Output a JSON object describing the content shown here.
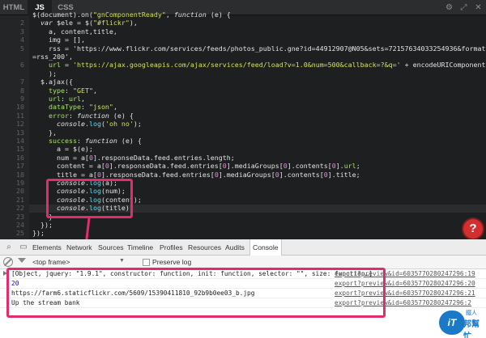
{
  "editor": {
    "tabs": [
      "HTML",
      "JS",
      "CSS"
    ],
    "active_tab": "JS",
    "toolbar_icons": [
      "settings-icon",
      "expand-icon",
      "close-icon"
    ],
    "lines": [
      {
        "num": "",
        "text": "$(document).on(\"gnComponentReady\", function (e) {"
      },
      {
        "num": "2",
        "text": "  var $ele = $(\"#flickr\"),"
      },
      {
        "num": "3",
        "text": "    a, content,title,"
      },
      {
        "num": "4",
        "text": "    img = [],"
      },
      {
        "num": "5",
        "text": "    rss = 'https://www.flickr.com/services/feeds/photos_public.gne?id=44912907@N05&sets=72157634033254936&format"
      },
      {
        "num": "",
        "text": "=rss_200',"
      },
      {
        "num": "6",
        "text": "    url = 'https://ajax.googleapis.com/ajax/services/feed/load?v=1.0&num=500&callback=?&q=' + encodeURIComponent(rss"
      },
      {
        "num": "",
        "text": "    );"
      },
      {
        "num": "7",
        "text": "  $.ajax({"
      },
      {
        "num": "8",
        "text": "    type: \"GET\","
      },
      {
        "num": "9",
        "text": "    url: url,"
      },
      {
        "num": "10",
        "text": "    dataType: \"json\","
      },
      {
        "num": "11",
        "text": "    error: function (e) {"
      },
      {
        "num": "12",
        "text": "      console.log('oh no');"
      },
      {
        "num": "13",
        "text": "    },"
      },
      {
        "num": "14",
        "text": "    success: function (e) {"
      },
      {
        "num": "15",
        "text": "      a = $(e);"
      },
      {
        "num": "16",
        "text": "      num = a[0].responseData.feed.entries.length;"
      },
      {
        "num": "17",
        "text": "      content = a[0].responseData.feed.entries[0].mediaGroups[0].contents[0].url;"
      },
      {
        "num": "18",
        "text": "      title = a[0].responseData.feed.entries[0].mediaGroups[0].contents[0].title;"
      },
      {
        "num": "19",
        "text": "      console.log(a);"
      },
      {
        "num": "20",
        "text": "      console.log(num);"
      },
      {
        "num": "21",
        "text": "      console.log(content);"
      },
      {
        "num": "22",
        "text": "      console.log(title);"
      },
      {
        "num": "23",
        "text": "    }"
      },
      {
        "num": "24",
        "text": "  });"
      },
      {
        "num": "25",
        "text": "});"
      }
    ],
    "help_label": "?"
  },
  "devtools": {
    "tabs": [
      "Elements",
      "Network",
      "Sources",
      "Timeline",
      "Profiles",
      "Resources",
      "Audits",
      "Console"
    ],
    "active_tab": "Console",
    "frame_select": "<top frame>",
    "preserve_log_label": "Preserve log",
    "console_rows": [
      {
        "text": "[Object, jquery: \"1.9.1\", constructor: function, init: function, selector: \"\", size: function…]",
        "link": "export?preview&id=6035770280247296:19"
      },
      {
        "text": "20",
        "link": "export?preview&id=6035770280247296:20"
      },
      {
        "text": "https://farm6.staticflickr.com/5609/15390411810_92b9b0ee03_b.jpg",
        "link": "export?preview&id=6035770280247296:21"
      },
      {
        "text": "Up the stream bank",
        "link": "export?preview&id=6035770280247296:2"
      }
    ]
  },
  "watermark": {
    "logo": "iT",
    "text": "邦幫忙",
    "sub": "鐵人"
  },
  "colors": {
    "highlight": "#e22c6c",
    "editor_bg": "#1d1f20",
    "keyword": "#f2563b",
    "string": "#d6e25a"
  }
}
